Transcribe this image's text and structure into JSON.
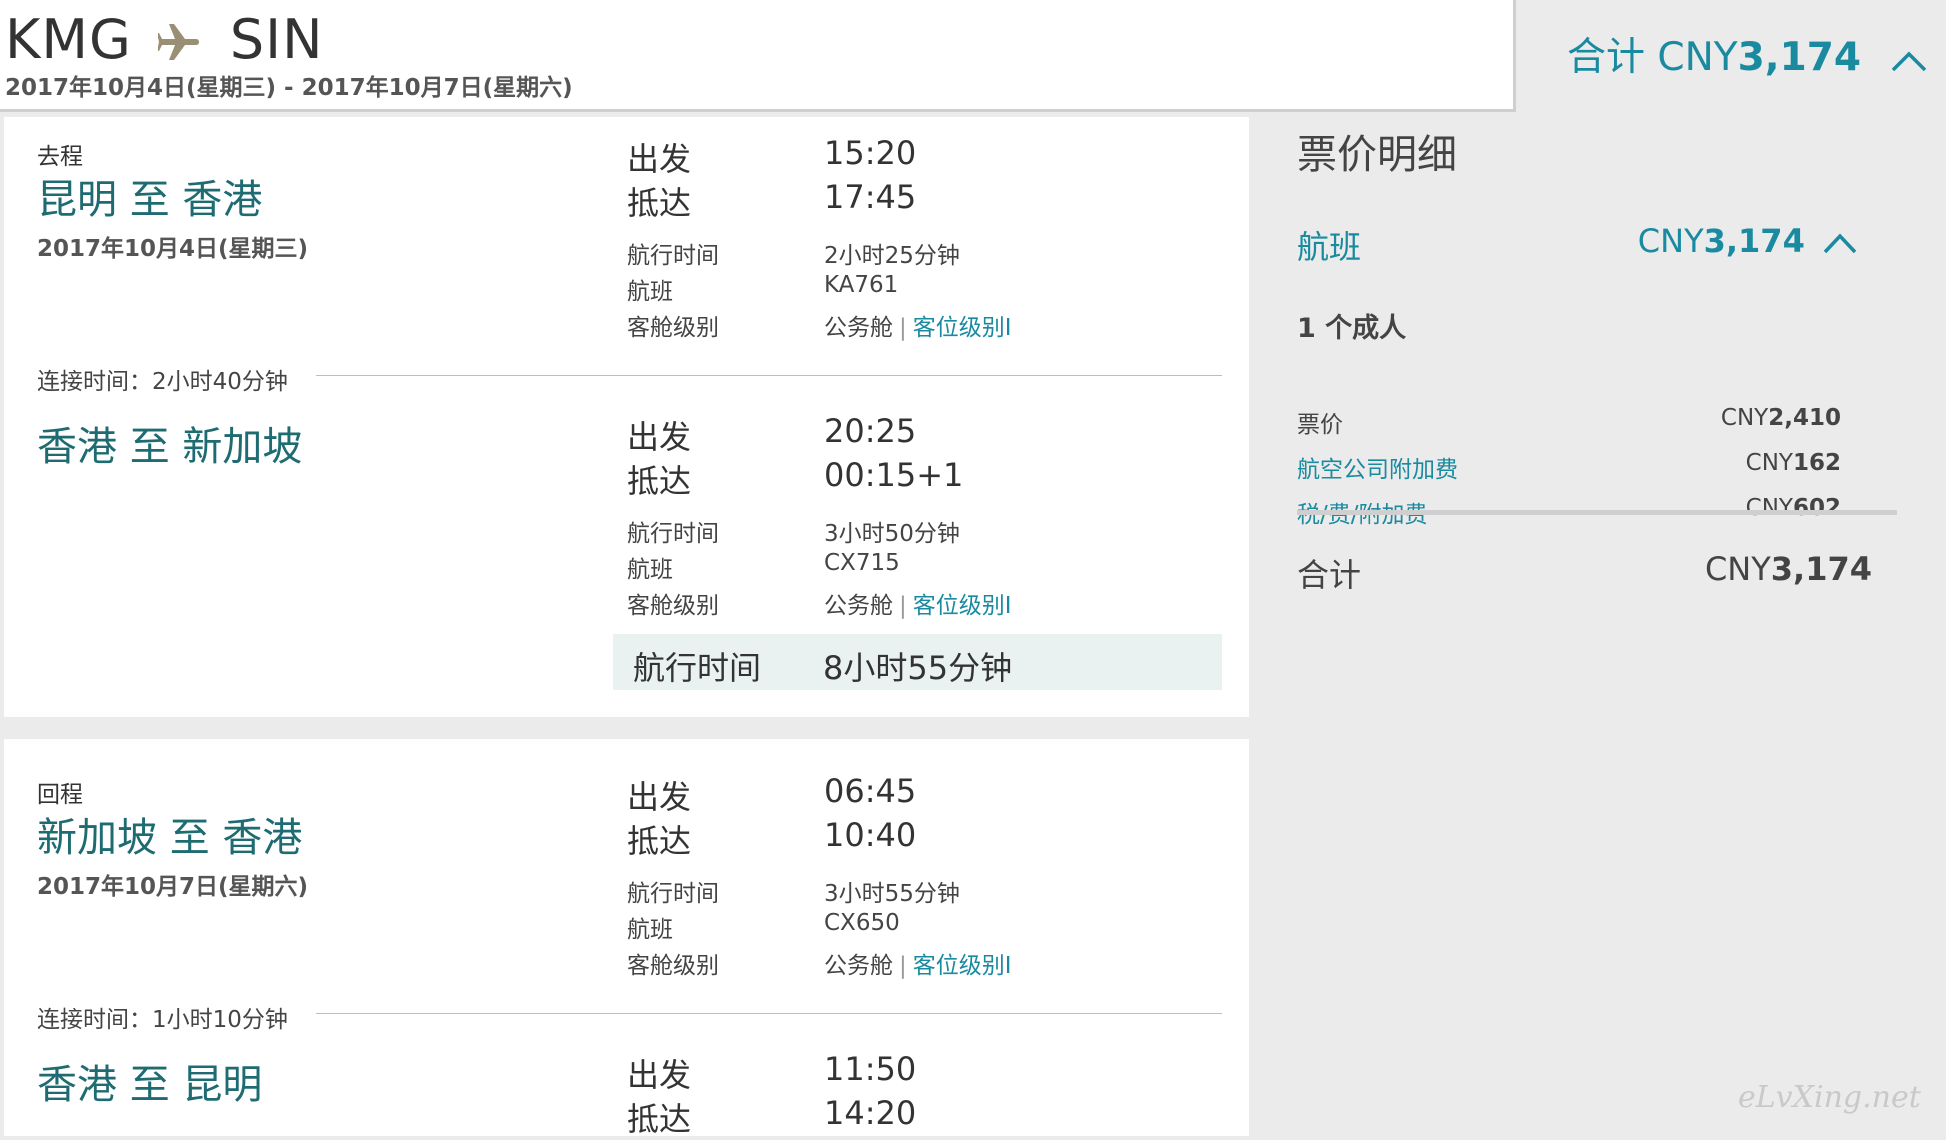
{
  "header": {
    "origin": "KMG",
    "destination": "SIN",
    "dates": "2017年10月4日(星期三) - 2017年10月7日(星期六)",
    "total_prefix": "合计 CNY",
    "total_amount": "3,174"
  },
  "labels": {
    "depart": "出发",
    "arrive": "抵达",
    "duration": "航行时间",
    "flight": "航班",
    "cabin": "客舱级别",
    "cabin_class": "公务舱",
    "cabin_link": "客位级别I"
  },
  "outbound": {
    "label": "去程",
    "date": "2017年10月4日(星期三)",
    "total_duration_label": "航行时间",
    "total_duration": "8小时55分钟",
    "connection": "连接时间：2小时40分钟",
    "segments": [
      {
        "route": "昆明 至 香港",
        "depart": "15:20",
        "arrive": "17:45",
        "duration": "2小时25分钟",
        "flight": "KA761"
      },
      {
        "route": "香港 至 新加坡",
        "depart": "20:25",
        "arrive": "00:15+1",
        "duration": "3小时50分钟",
        "flight": "CX715"
      }
    ]
  },
  "return": {
    "label": "回程",
    "date": "2017年10月7日(星期六)",
    "connection": "连接时间：1小时10分钟",
    "segments": [
      {
        "route": "新加坡 至 香港",
        "depart": "06:45",
        "arrive": "10:40",
        "duration": "3小时55分钟",
        "flight": "CX650"
      },
      {
        "route": "香港 至 昆明",
        "depart": "11:50",
        "arrive": "14:20"
      }
    ]
  },
  "price": {
    "title": "票价明细",
    "flight_label": "航班",
    "currency": "CNY",
    "flight_amount": "3,174",
    "passengers": "1 个成人",
    "rows": [
      {
        "label": "票价",
        "amount": "2,410"
      },
      {
        "label": "航空公司附加费",
        "amount": "162"
      },
      {
        "label": "税/费/附加费",
        "amount": "602"
      }
    ],
    "total_label": "合计",
    "total_amount": "3,174"
  },
  "watermark": "eLvXing.net",
  "colors": {
    "teal": "#1e6b72",
    "link": "#1a8aa0",
    "highlight": "#e9f1f1"
  }
}
